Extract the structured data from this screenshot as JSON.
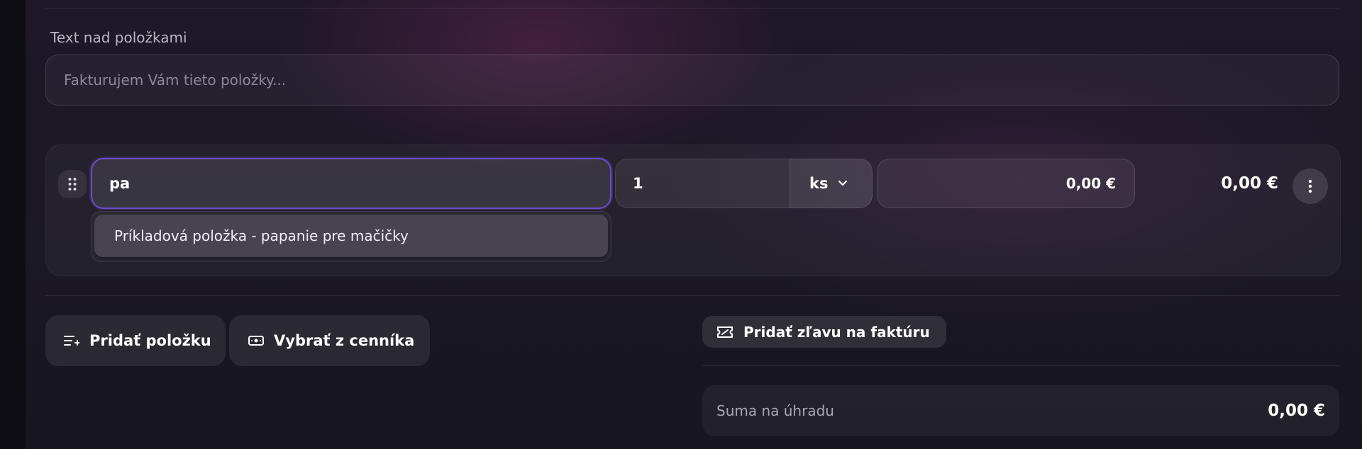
{
  "text_above_items": {
    "label": "Text nad položkami",
    "placeholder": "Fakturujem Vám tieto položky..."
  },
  "item_row": {
    "name_value": "pa",
    "quantity": "1",
    "unit": "ks",
    "unit_price": "0,00 €",
    "total": "0,00 €",
    "suggestion": "Príkladová položka - papanie pre mačičky"
  },
  "actions": {
    "add_item": "Pridať položku",
    "select_from_pricelist": "Vybrať z cenníka",
    "add_discount": "Pridať zľavu na faktúru"
  },
  "summary": {
    "label": "Suma na úhradu",
    "value": "0,00 €"
  },
  "colors": {
    "focus_accent": "#6b4dc7",
    "background": "#1b1824"
  }
}
